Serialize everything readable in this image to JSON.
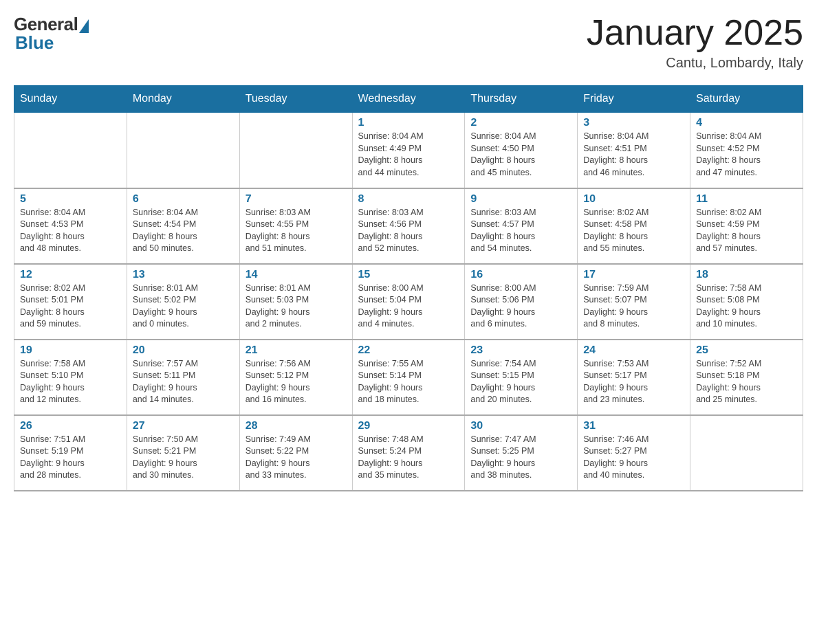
{
  "header": {
    "logo": {
      "general": "General",
      "blue": "Blue"
    },
    "title": "January 2025",
    "location": "Cantu, Lombardy, Italy"
  },
  "days_of_week": [
    "Sunday",
    "Monday",
    "Tuesday",
    "Wednesday",
    "Thursday",
    "Friday",
    "Saturday"
  ],
  "weeks": [
    [
      {
        "day": "",
        "info": ""
      },
      {
        "day": "",
        "info": ""
      },
      {
        "day": "",
        "info": ""
      },
      {
        "day": "1",
        "info": "Sunrise: 8:04 AM\nSunset: 4:49 PM\nDaylight: 8 hours\nand 44 minutes."
      },
      {
        "day": "2",
        "info": "Sunrise: 8:04 AM\nSunset: 4:50 PM\nDaylight: 8 hours\nand 45 minutes."
      },
      {
        "day": "3",
        "info": "Sunrise: 8:04 AM\nSunset: 4:51 PM\nDaylight: 8 hours\nand 46 minutes."
      },
      {
        "day": "4",
        "info": "Sunrise: 8:04 AM\nSunset: 4:52 PM\nDaylight: 8 hours\nand 47 minutes."
      }
    ],
    [
      {
        "day": "5",
        "info": "Sunrise: 8:04 AM\nSunset: 4:53 PM\nDaylight: 8 hours\nand 48 minutes."
      },
      {
        "day": "6",
        "info": "Sunrise: 8:04 AM\nSunset: 4:54 PM\nDaylight: 8 hours\nand 50 minutes."
      },
      {
        "day": "7",
        "info": "Sunrise: 8:03 AM\nSunset: 4:55 PM\nDaylight: 8 hours\nand 51 minutes."
      },
      {
        "day": "8",
        "info": "Sunrise: 8:03 AM\nSunset: 4:56 PM\nDaylight: 8 hours\nand 52 minutes."
      },
      {
        "day": "9",
        "info": "Sunrise: 8:03 AM\nSunset: 4:57 PM\nDaylight: 8 hours\nand 54 minutes."
      },
      {
        "day": "10",
        "info": "Sunrise: 8:02 AM\nSunset: 4:58 PM\nDaylight: 8 hours\nand 55 minutes."
      },
      {
        "day": "11",
        "info": "Sunrise: 8:02 AM\nSunset: 4:59 PM\nDaylight: 8 hours\nand 57 minutes."
      }
    ],
    [
      {
        "day": "12",
        "info": "Sunrise: 8:02 AM\nSunset: 5:01 PM\nDaylight: 8 hours\nand 59 minutes."
      },
      {
        "day": "13",
        "info": "Sunrise: 8:01 AM\nSunset: 5:02 PM\nDaylight: 9 hours\nand 0 minutes."
      },
      {
        "day": "14",
        "info": "Sunrise: 8:01 AM\nSunset: 5:03 PM\nDaylight: 9 hours\nand 2 minutes."
      },
      {
        "day": "15",
        "info": "Sunrise: 8:00 AM\nSunset: 5:04 PM\nDaylight: 9 hours\nand 4 minutes."
      },
      {
        "day": "16",
        "info": "Sunrise: 8:00 AM\nSunset: 5:06 PM\nDaylight: 9 hours\nand 6 minutes."
      },
      {
        "day": "17",
        "info": "Sunrise: 7:59 AM\nSunset: 5:07 PM\nDaylight: 9 hours\nand 8 minutes."
      },
      {
        "day": "18",
        "info": "Sunrise: 7:58 AM\nSunset: 5:08 PM\nDaylight: 9 hours\nand 10 minutes."
      }
    ],
    [
      {
        "day": "19",
        "info": "Sunrise: 7:58 AM\nSunset: 5:10 PM\nDaylight: 9 hours\nand 12 minutes."
      },
      {
        "day": "20",
        "info": "Sunrise: 7:57 AM\nSunset: 5:11 PM\nDaylight: 9 hours\nand 14 minutes."
      },
      {
        "day": "21",
        "info": "Sunrise: 7:56 AM\nSunset: 5:12 PM\nDaylight: 9 hours\nand 16 minutes."
      },
      {
        "day": "22",
        "info": "Sunrise: 7:55 AM\nSunset: 5:14 PM\nDaylight: 9 hours\nand 18 minutes."
      },
      {
        "day": "23",
        "info": "Sunrise: 7:54 AM\nSunset: 5:15 PM\nDaylight: 9 hours\nand 20 minutes."
      },
      {
        "day": "24",
        "info": "Sunrise: 7:53 AM\nSunset: 5:17 PM\nDaylight: 9 hours\nand 23 minutes."
      },
      {
        "day": "25",
        "info": "Sunrise: 7:52 AM\nSunset: 5:18 PM\nDaylight: 9 hours\nand 25 minutes."
      }
    ],
    [
      {
        "day": "26",
        "info": "Sunrise: 7:51 AM\nSunset: 5:19 PM\nDaylight: 9 hours\nand 28 minutes."
      },
      {
        "day": "27",
        "info": "Sunrise: 7:50 AM\nSunset: 5:21 PM\nDaylight: 9 hours\nand 30 minutes."
      },
      {
        "day": "28",
        "info": "Sunrise: 7:49 AM\nSunset: 5:22 PM\nDaylight: 9 hours\nand 33 minutes."
      },
      {
        "day": "29",
        "info": "Sunrise: 7:48 AM\nSunset: 5:24 PM\nDaylight: 9 hours\nand 35 minutes."
      },
      {
        "day": "30",
        "info": "Sunrise: 7:47 AM\nSunset: 5:25 PM\nDaylight: 9 hours\nand 38 minutes."
      },
      {
        "day": "31",
        "info": "Sunrise: 7:46 AM\nSunset: 5:27 PM\nDaylight: 9 hours\nand 40 minutes."
      },
      {
        "day": "",
        "info": ""
      }
    ]
  ]
}
